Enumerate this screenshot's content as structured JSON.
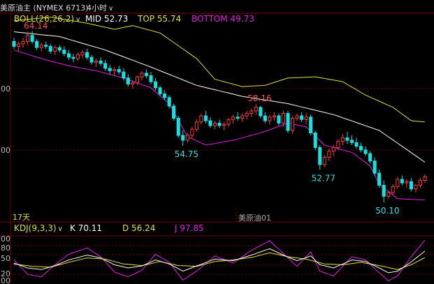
{
  "topbar": {
    "symbol": "美原油主 (NYMEX 6713)",
    "period": "4小时"
  },
  "boll_legend": {
    "name": "BOLL(26,26,2)",
    "mid": "MID 52.73",
    "top": "TOP 55.74",
    "bottom": "BOTTOM 49.73"
  },
  "kdj_legend": {
    "name": "KDJ(9,3,3)",
    "k": "K 70.11",
    "d": "D 56.24",
    "j": "J 97.85"
  },
  "colors": {
    "up": "#ff3b3b",
    "down": "#18e0e0",
    "mid": "#ffffff",
    "top": "#e0e040",
    "bottom": "#e020e0",
    "k": "#ffffff",
    "d": "#e0e040",
    "j": "#e020e0",
    "grid": "#7a0000"
  },
  "labels": {
    "days": "17天",
    "contract": "美原油01",
    "y_a": "00",
    "y_b": "00",
    "k_y1": "00",
    "k_y2": "80",
    "k_y3": "50",
    "k_y4": "20",
    "k_y5": "00"
  },
  "chart_data": {
    "type": "candlestick",
    "title": "美原油主 (NYMEX 6713) 4小时",
    "annotations": [
      {
        "text": "64.14",
        "kind": "high"
      },
      {
        "text": "58.16",
        "kind": "high"
      },
      {
        "text": "54.75",
        "kind": "low"
      },
      {
        "text": "52.77",
        "kind": "low"
      },
      {
        "text": "50.10",
        "kind": "low"
      }
    ],
    "ylim": [
      48.5,
      65.5
    ],
    "candles": [
      [
        63.3,
        63.6,
        62.7,
        62.9
      ],
      [
        62.9,
        63.3,
        62.5,
        63.1
      ],
      [
        63.1,
        63.6,
        62.8,
        63.3
      ],
      [
        63.3,
        64.1,
        63.0,
        63.8
      ],
      [
        63.8,
        64.14,
        63.1,
        63.3
      ],
      [
        63.3,
        63.5,
        62.6,
        62.8
      ],
      [
        62.8,
        63.2,
        62.5,
        63.0
      ],
      [
        63.0,
        63.3,
        62.7,
        62.9
      ],
      [
        62.9,
        63.1,
        62.3,
        62.5
      ],
      [
        62.5,
        63.0,
        62.2,
        62.8
      ],
      [
        62.8,
        63.0,
        62.4,
        62.6
      ],
      [
        62.6,
        62.9,
        62.1,
        62.3
      ],
      [
        62.3,
        62.6,
        61.8,
        62.0
      ],
      [
        62.0,
        62.3,
        61.6,
        61.9
      ],
      [
        61.9,
        62.4,
        61.7,
        62.2
      ],
      [
        62.2,
        62.6,
        61.9,
        62.4
      ],
      [
        62.4,
        62.7,
        61.8,
        62.0
      ],
      [
        62.0,
        62.2,
        61.4,
        61.6
      ],
      [
        61.6,
        61.9,
        61.2,
        61.7
      ],
      [
        61.7,
        62.0,
        61.3,
        61.5
      ],
      [
        61.5,
        61.8,
        60.9,
        61.1
      ],
      [
        61.1,
        61.4,
        60.6,
        60.9
      ],
      [
        60.9,
        61.2,
        60.5,
        61.0
      ],
      [
        61.0,
        61.3,
        60.6,
        60.8
      ],
      [
        60.8,
        61.1,
        60.1,
        60.3
      ],
      [
        60.3,
        60.6,
        59.6,
        59.8
      ],
      [
        59.8,
        60.1,
        59.4,
        59.9
      ],
      [
        59.9,
        60.5,
        59.7,
        60.4
      ],
      [
        60.4,
        60.9,
        60.1,
        60.7
      ],
      [
        60.7,
        61.0,
        60.3,
        60.5
      ],
      [
        60.5,
        60.8,
        59.8,
        60.0
      ],
      [
        60.0,
        60.3,
        59.3,
        59.5
      ],
      [
        59.5,
        59.7,
        58.8,
        59.0
      ],
      [
        59.0,
        59.3,
        58.5,
        58.7
      ],
      [
        58.7,
        58.9,
        57.8,
        58.0
      ],
      [
        58.0,
        58.2,
        56.8,
        57.0
      ],
      [
        57.0,
        57.2,
        55.4,
        55.6
      ],
      [
        55.6,
        56.0,
        54.75,
        55.2
      ],
      [
        55.2,
        55.8,
        55.0,
        55.6
      ],
      [
        55.6,
        56.3,
        55.3,
        56.1
      ],
      [
        56.1,
        56.9,
        55.9,
        56.7
      ],
      [
        56.7,
        57.4,
        56.5,
        57.2
      ],
      [
        57.2,
        57.6,
        56.6,
        56.8
      ],
      [
        56.8,
        57.1,
        56.2,
        56.4
      ],
      [
        56.4,
        56.8,
        56.1,
        56.6
      ],
      [
        56.6,
        56.9,
        56.2,
        56.4
      ],
      [
        56.4,
        56.7,
        56.0,
        56.5
      ],
      [
        56.5,
        57.0,
        56.3,
        56.9
      ],
      [
        56.9,
        57.3,
        56.6,
        57.1
      ],
      [
        57.1,
        57.5,
        56.8,
        57.0
      ],
      [
        57.0,
        57.4,
        56.7,
        57.2
      ],
      [
        57.2,
        57.6,
        56.9,
        57.4
      ],
      [
        57.4,
        57.8,
        57.1,
        57.6
      ],
      [
        57.6,
        58.16,
        57.3,
        57.9
      ],
      [
        57.9,
        58.0,
        57.0,
        57.2
      ],
      [
        57.2,
        57.5,
        56.6,
        56.8
      ],
      [
        56.8,
        57.3,
        56.5,
        57.1
      ],
      [
        57.1,
        57.5,
        56.8,
        57.2
      ],
      [
        57.2,
        57.4,
        56.4,
        56.6
      ],
      [
        56.6,
        57.6,
        56.3,
        57.4
      ],
      [
        57.4,
        57.6,
        55.8,
        56.0
      ],
      [
        56.0,
        57.2,
        55.7,
        57.0
      ],
      [
        57.0,
        57.4,
        56.8,
        57.2
      ],
      [
        57.2,
        57.5,
        56.7,
        56.9
      ],
      [
        56.9,
        57.4,
        56.5,
        57.1
      ],
      [
        57.1,
        57.3,
        55.6,
        55.8
      ],
      [
        55.8,
        56.0,
        54.4,
        54.6
      ],
      [
        54.6,
        54.8,
        52.77,
        53.2
      ],
      [
        53.2,
        54.0,
        53.0,
        53.8
      ],
      [
        53.8,
        54.5,
        53.5,
        54.3
      ],
      [
        54.3,
        54.8,
        53.9,
        54.6
      ],
      [
        54.6,
        55.3,
        54.4,
        55.1
      ],
      [
        55.1,
        55.7,
        54.8,
        55.4
      ],
      [
        55.4,
        55.9,
        54.9,
        55.2
      ],
      [
        55.2,
        55.6,
        54.8,
        55.0
      ],
      [
        55.0,
        55.4,
        54.5,
        54.7
      ],
      [
        54.7,
        55.0,
        54.2,
        54.4
      ],
      [
        54.4,
        54.7,
        53.9,
        54.1
      ],
      [
        54.1,
        54.3,
        53.3,
        53.5
      ],
      [
        53.5,
        53.8,
        52.3,
        52.5
      ],
      [
        52.5,
        52.8,
        51.3,
        51.5
      ],
      [
        51.5,
        51.9,
        50.1,
        50.6
      ],
      [
        50.6,
        51.0,
        50.4,
        50.9
      ],
      [
        50.9,
        51.6,
        50.7,
        51.4
      ],
      [
        51.4,
        52.2,
        51.2,
        52.0
      ],
      [
        52.0,
        52.3,
        51.5,
        51.7
      ],
      [
        51.7,
        52.0,
        51.3,
        51.8
      ],
      [
        51.8,
        52.1,
        51.0,
        51.2
      ],
      [
        51.2,
        51.6,
        50.9,
        51.5
      ],
      [
        51.5,
        52.1,
        51.3,
        51.9
      ],
      [
        51.9,
        52.4,
        51.7,
        52.2
      ]
    ],
    "boll_mid_ctrl": [
      [
        0,
        64.1
      ],
      [
        10,
        63.7
      ],
      [
        20,
        62.6
      ],
      [
        30,
        61.2
      ],
      [
        40,
        59.7
      ],
      [
        50,
        58.8
      ],
      [
        60,
        58.2
      ],
      [
        70,
        57.3
      ],
      [
        80,
        56.0
      ],
      [
        90,
        53.4
      ]
    ],
    "boll_top_ctrl": [
      [
        0,
        65.0
      ],
      [
        8,
        65.3
      ],
      [
        16,
        64.8
      ],
      [
        22,
        64.3
      ],
      [
        26,
        64.6
      ],
      [
        32,
        64.0
      ],
      [
        40,
        61.9
      ],
      [
        44,
        60.2
      ],
      [
        50,
        59.6
      ],
      [
        55,
        59.7
      ],
      [
        60,
        60.3
      ],
      [
        66,
        60.4
      ],
      [
        72,
        60.0
      ],
      [
        77,
        58.9
      ],
      [
        83,
        57.9
      ],
      [
        87,
        56.8
      ],
      [
        90,
        56.7
      ]
    ],
    "boll_bot_ctrl": [
      [
        0,
        62.6
      ],
      [
        6,
        61.9
      ],
      [
        12,
        61.3
      ],
      [
        18,
        60.9
      ],
      [
        24,
        60.3
      ],
      [
        30,
        59.5
      ],
      [
        34,
        58.2
      ],
      [
        38,
        55.5
      ],
      [
        42,
        54.8
      ],
      [
        48,
        55.2
      ],
      [
        54,
        55.8
      ],
      [
        60,
        56.6
      ],
      [
        64,
        56.3
      ],
      [
        68,
        54.8
      ],
      [
        74,
        54.2
      ],
      [
        78,
        53.1
      ],
      [
        80,
        51.6
      ],
      [
        84,
        50.4
      ],
      [
        90,
        50.3
      ]
    ],
    "kdj_ylim": [
      -10,
      110
    ],
    "kdj_k_ctrl": [
      [
        0,
        42
      ],
      [
        3,
        30
      ],
      [
        6,
        26
      ],
      [
        9,
        36
      ],
      [
        12,
        50
      ],
      [
        16,
        62
      ],
      [
        19,
        55
      ],
      [
        22,
        38
      ],
      [
        25,
        30
      ],
      [
        28,
        35
      ],
      [
        31,
        50
      ],
      [
        34,
        40
      ],
      [
        37,
        22
      ],
      [
        40,
        35
      ],
      [
        44,
        52
      ],
      [
        48,
        48
      ],
      [
        52,
        62
      ],
      [
        56,
        78
      ],
      [
        59,
        62
      ],
      [
        62,
        48
      ],
      [
        65,
        60
      ],
      [
        67,
        38
      ],
      [
        70,
        30
      ],
      [
        74,
        50
      ],
      [
        77,
        46
      ],
      [
        80,
        30
      ],
      [
        82,
        18
      ],
      [
        84,
        22
      ],
      [
        87,
        45
      ],
      [
        90,
        72
      ]
    ],
    "kdj_d_ctrl": [
      [
        0,
        40
      ],
      [
        4,
        34
      ],
      [
        8,
        32
      ],
      [
        12,
        44
      ],
      [
        16,
        55
      ],
      [
        20,
        52
      ],
      [
        24,
        40
      ],
      [
        28,
        36
      ],
      [
        32,
        46
      ],
      [
        36,
        36
      ],
      [
        40,
        34
      ],
      [
        44,
        46
      ],
      [
        48,
        50
      ],
      [
        52,
        56
      ],
      [
        56,
        68
      ],
      [
        60,
        58
      ],
      [
        64,
        52
      ],
      [
        68,
        40
      ],
      [
        72,
        38
      ],
      [
        76,
        44
      ],
      [
        80,
        36
      ],
      [
        84,
        26
      ],
      [
        87,
        38
      ],
      [
        90,
        56
      ]
    ],
    "kdj_j_ctrl": [
      [
        0,
        50
      ],
      [
        3,
        14
      ],
      [
        6,
        8
      ],
      [
        9,
        38
      ],
      [
        12,
        64
      ],
      [
        16,
        80
      ],
      [
        19,
        58
      ],
      [
        22,
        20
      ],
      [
        25,
        8
      ],
      [
        28,
        24
      ],
      [
        31,
        64
      ],
      [
        34,
        44
      ],
      [
        37,
        0
      ],
      [
        40,
        22
      ],
      [
        44,
        60
      ],
      [
        48,
        42
      ],
      [
        52,
        74
      ],
      [
        56,
        98
      ],
      [
        59,
        66
      ],
      [
        62,
        34
      ],
      [
        65,
        70
      ],
      [
        67,
        22
      ],
      [
        70,
        10
      ],
      [
        74,
        58
      ],
      [
        77,
        50
      ],
      [
        80,
        18
      ],
      [
        82,
        -2
      ],
      [
        84,
        10
      ],
      [
        87,
        58
      ],
      [
        90,
        99
      ]
    ]
  }
}
